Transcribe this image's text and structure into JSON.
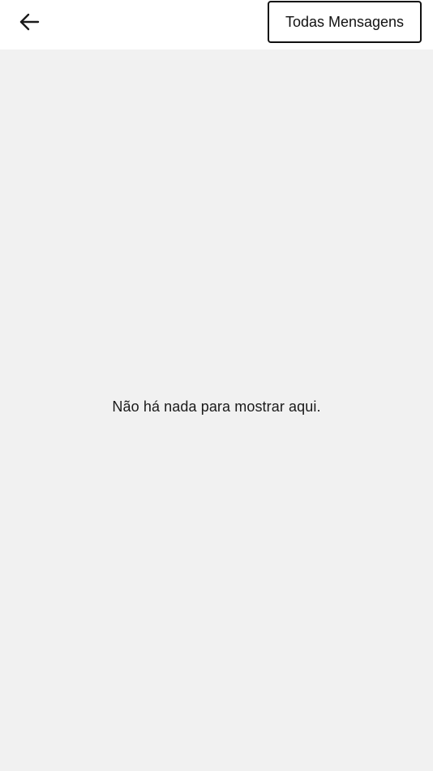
{
  "header": {
    "back_icon": "arrow-left-icon",
    "filter_button_label": "Todas Mensagens"
  },
  "content": {
    "empty_message": "Não há nada para mostrar aqui."
  },
  "colors": {
    "header_background": "#ffffff",
    "content_background": "#f1f1f1",
    "text": "#1a1a1a",
    "button_border": "#111111"
  }
}
